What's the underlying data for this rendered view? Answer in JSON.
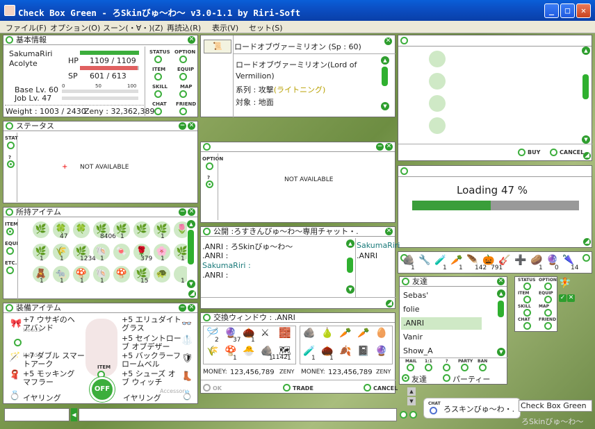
{
  "window": {
    "title": "Check Box Green - ろSkinびゅ～わ～ v3.0-1.1 by Riri-Soft",
    "min": "_",
    "max": "□",
    "close": "✕"
  },
  "menu": [
    "ファイル(F)",
    "オプション(O)",
    "スーン(・∀・)(Z)",
    "再読込(R)",
    "表示(V)",
    "セット(S)"
  ],
  "basic": {
    "title": "基本情報",
    "name": "SakumaRiri",
    "job": "Acolyte",
    "hp_label": "HP",
    "hp": "1109 / 1109",
    "sp_label": "SP",
    "sp": "601 / 613",
    "base": "Base Lv. 60",
    "joblv": "Job Lv. 47",
    "scale0": "0",
    "scale50": "50",
    "scale100": "100",
    "weight": "Weight : 1003 / 2430",
    "zeny": "Zeny : 32,362,389",
    "hp_frac": 1.0,
    "sp_frac": 0.98,
    "btns": [
      "STATUS",
      "OPTION",
      "ITEM",
      "EQUIP",
      "SKILL",
      "MAP",
      "CHAT",
      "FRIEND"
    ]
  },
  "skill": {
    "title": "ロードオブヴァーミリオン (Sp : 60)",
    "desc1": "ロードオブヴァーミリオン(Lord of",
    "desc2": "Vermilion)",
    "type_label": "系列 : 攻撃",
    "type_val": "(ライトニング)",
    "target": "対象 : 地面"
  },
  "status": {
    "title": "ステータス",
    "stat": "STAT",
    "q": "?",
    "na": "NOT AVAILABLE",
    "plus": "+"
  },
  "option": {
    "label": "OPTION",
    "q": "?",
    "na": "NOT AVAILABLE"
  },
  "items": {
    "title": "所持アイテム",
    "tabs": [
      "ITEM",
      "EQUI",
      "ETC."
    ],
    "counts": [
      "",
      "47",
      "",
      "8406",
      "1",
      "",
      "1",
      "",
      "1",
      "1",
      "1234",
      "1",
      "",
      "379",
      "1",
      "1",
      "1",
      "1",
      "1",
      "1",
      "",
      "15",
      "",
      "1",
      "",
      "",
      ""
    ]
  },
  "equip": {
    "title": "装備アイテム",
    "left": [
      "+7 ウサギのヘアバンド",
      "+7 ダブル スマートアーク",
      "+5 モッキングマフラー",
      "イヤリング"
    ],
    "right": [
      "+5 エリュダイトグラス",
      "+5 セイントローブ オブデザー",
      "+5 バックラーフロームベル",
      "+5 シューズ オブ ウィッチ",
      "イヤリング"
    ],
    "item": "ITEM",
    "off": "OFF",
    "ghost1": "Head3",
    "ghost2": "Head2",
    "ghost3": "Accessory"
  },
  "chat": {
    "title": "公開 :ろすきんびゅ～わ～専用チャット・.",
    "lines": [
      ".ANRI : ろSkinびゅ～わ～",
      ".ANRI :",
      "SakumaRiri :",
      ".ANRI :"
    ],
    "members": [
      "SakumaRiri",
      ".ANRI"
    ]
  },
  "trade": {
    "title": "交換ウィンドウ : .ANRI",
    "left_counts": [
      "2",
      "37",
      "1",
      "",
      "",
      "",
      "1",
      "",
      "1",
      "1"
    ],
    "right_counts": [
      "",
      "",
      "",
      "",
      "",
      "1",
      "1",
      "",
      "",
      ""
    ],
    "mid": "1142",
    "mid2": "1",
    "money_label": "MONEY:",
    "money_left": "123,456,789",
    "money_right": "123,456,789",
    "zeny": "ZENY",
    "ok": "OK",
    "trade": "TRADE",
    "cancel": "CANCEL"
  },
  "shop": {
    "buy": "BUY",
    "cancel": "CANCEL"
  },
  "loading": {
    "text": "Loading 47 %",
    "pct": 0.47
  },
  "hotbar": {
    "counts": [
      "1",
      "",
      "1",
      "1",
      "142",
      "791",
      "",
      "",
      "1",
      "0",
      "14"
    ]
  },
  "friends": {
    "title": "友達",
    "list": [
      "Sebas'",
      "folie",
      ".ANRI",
      "Vanir",
      "Show_A"
    ],
    "selected": 2,
    "btns": [
      "MAIL",
      "1:1",
      "?",
      "PARTY",
      "BAN"
    ],
    "tab1": "友達",
    "tab2": "パーティー"
  },
  "minimenu": {
    "btns": [
      "STATUS",
      "OPTION",
      "ITEM",
      "EQUIP",
      "SKILL",
      "MAP",
      "CHAT",
      "FRIEND"
    ]
  },
  "bottom": {
    "chat_label": "CHAT",
    "chat_name": "ろスキンびゅ～わ・.",
    "skin_name": "Check Box Green",
    "skin_sub": "ろSkinびゅ～わ～"
  }
}
